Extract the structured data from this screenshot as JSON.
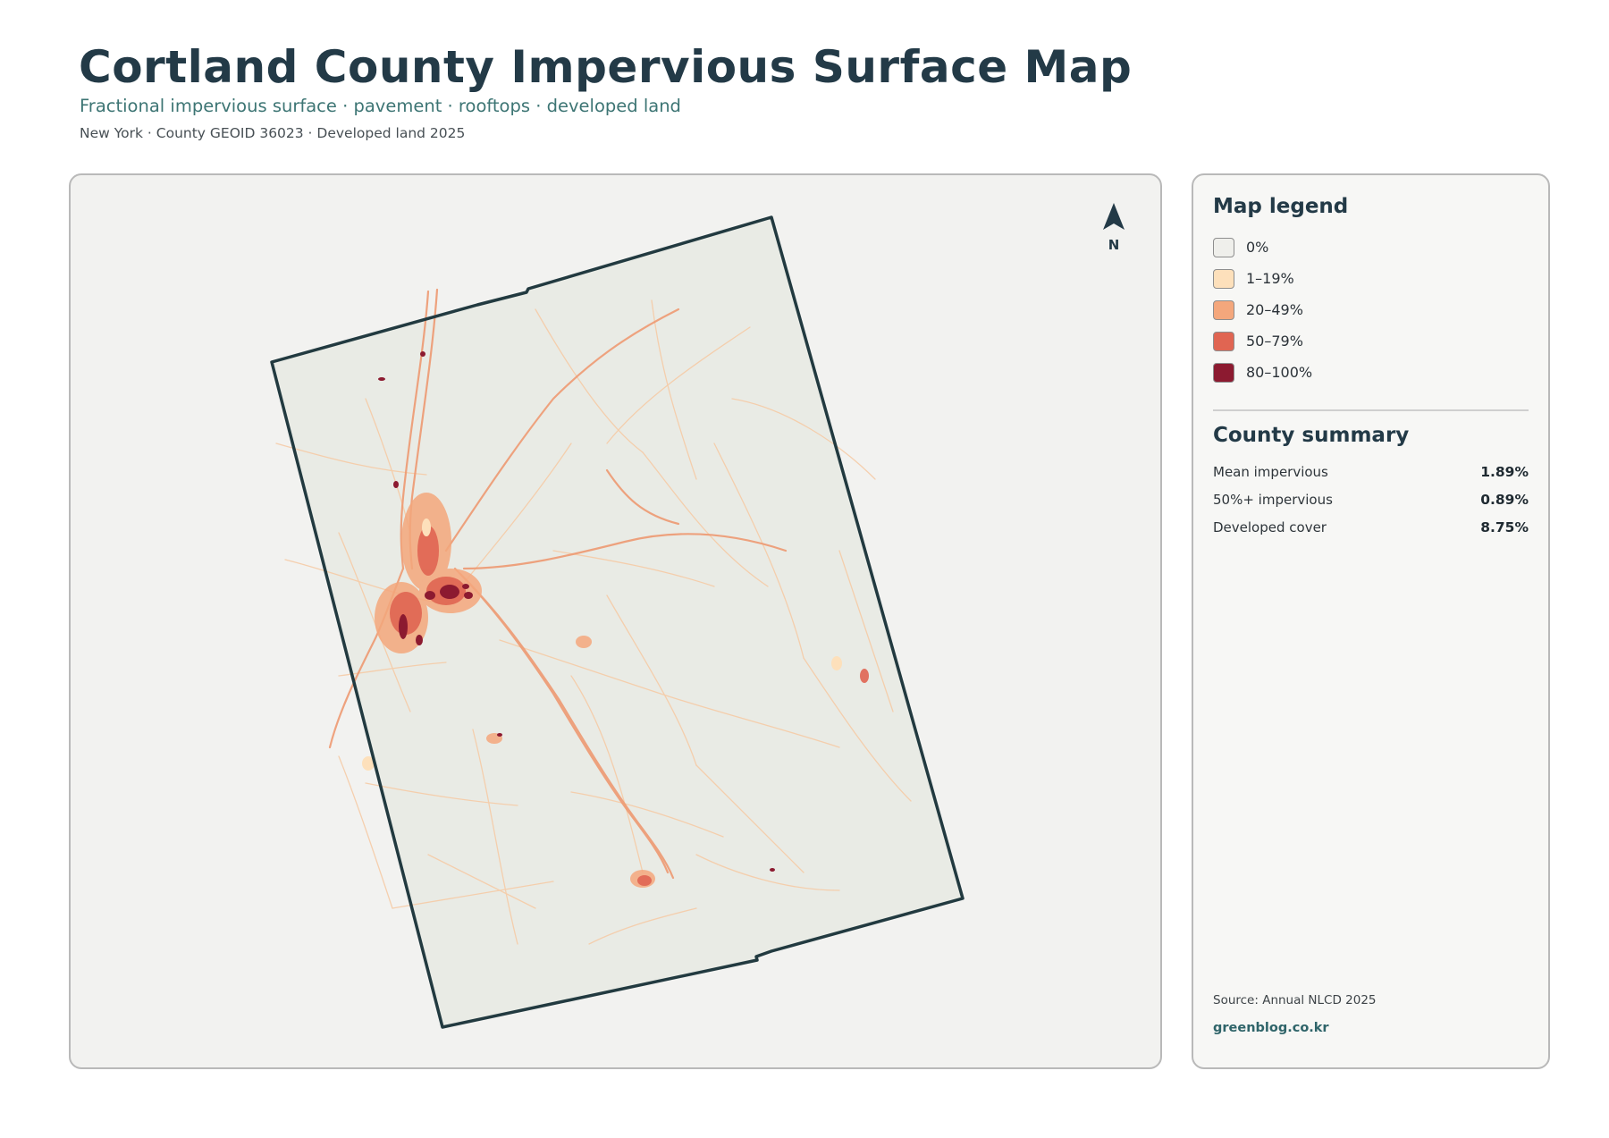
{
  "header": {
    "title": "Cortland County Impervious Surface Map",
    "subtitle": "Fractional impervious surface · pavement · rooftops · developed land",
    "meta": "New York · County GEOID 36023 · Developed land 2025"
  },
  "map": {
    "north_label": "N",
    "fill_color": "#e9ebe5",
    "outline_color": "#223a40"
  },
  "legend": {
    "title": "Map legend",
    "items": [
      {
        "label": "0%",
        "color": "#efefeb"
      },
      {
        "label": "1–19%",
        "color": "#fde0bb"
      },
      {
        "label": "20–49%",
        "color": "#f4a77c"
      },
      {
        "label": "50–79%",
        "color": "#e06552"
      },
      {
        "label": "80–100%",
        "color": "#8c1a30"
      }
    ]
  },
  "summary": {
    "title": "County summary",
    "stats": [
      {
        "label": "Mean impervious",
        "value": "1.89%"
      },
      {
        "label": "50%+ impervious",
        "value": "0.89%"
      },
      {
        "label": "Developed cover",
        "value": "8.75%"
      }
    ]
  },
  "footer": {
    "source": "Source: Annual NLCD 2025",
    "site": "greenblog.co.kr"
  }
}
